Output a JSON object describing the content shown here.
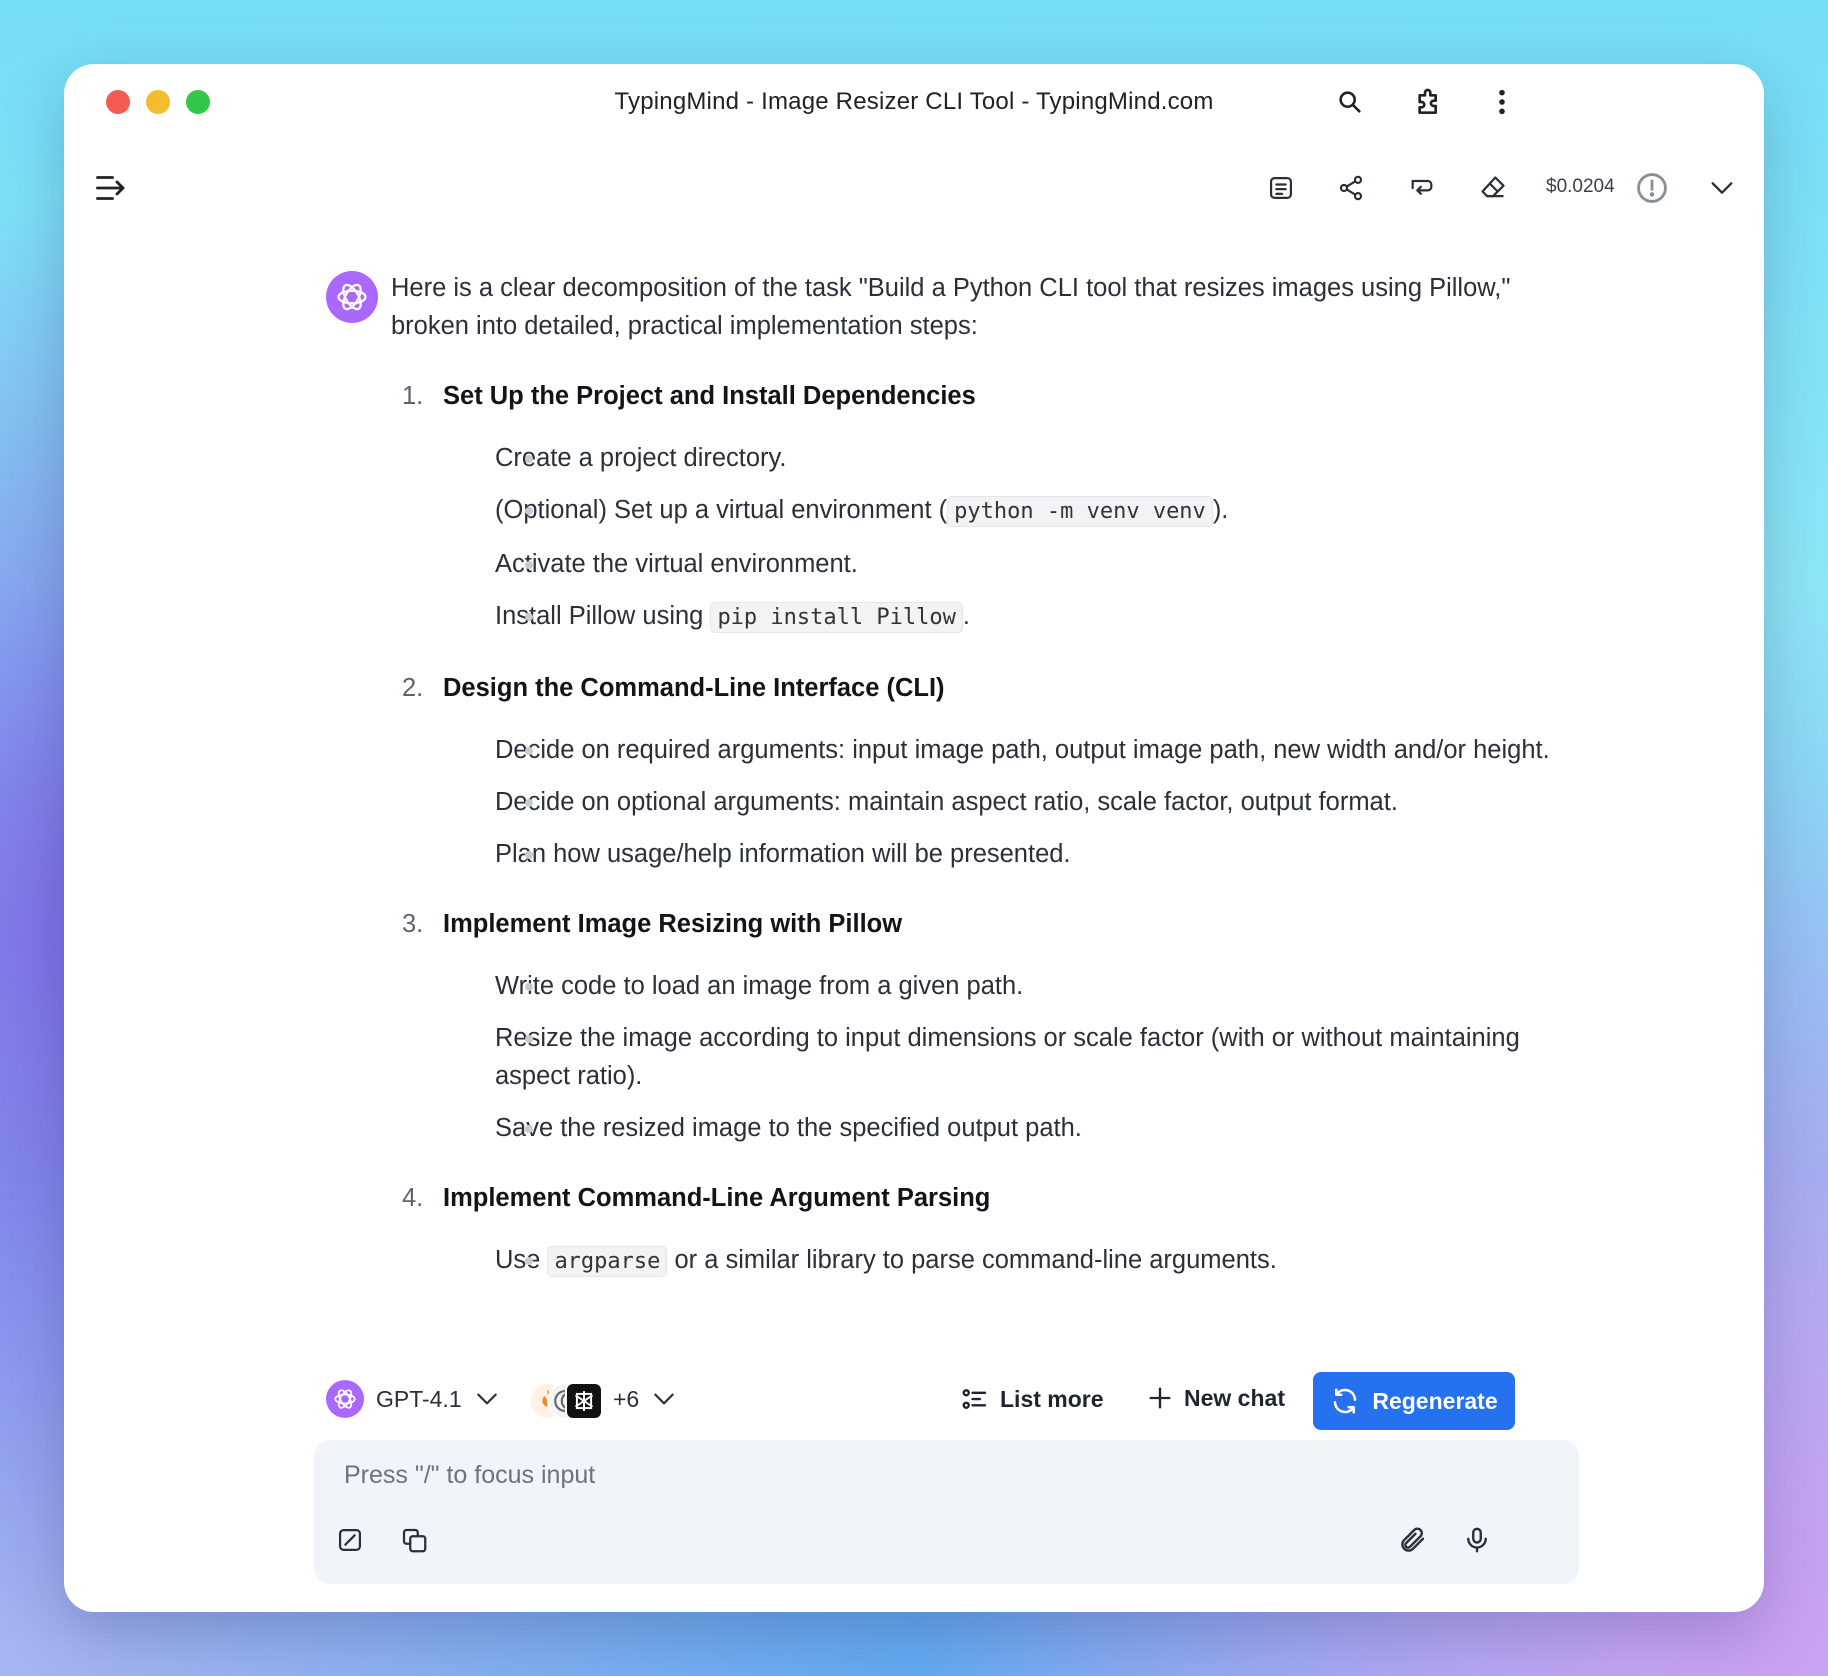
{
  "window": {
    "title": "TypingMind - Image Resizer CLI Tool - TypingMind.com"
  },
  "toolbar": {
    "cost": "$0.0204"
  },
  "message": {
    "intro": "Here is a clear decomposition of the task \"Build a Python CLI tool that resizes images using Pillow,\" broken into detailed, practical implementation steps:",
    "steps": [
      {
        "number": "1.",
        "title": "Set Up the Project and Install Dependencies",
        "bullets": [
          {
            "before": "Create a project directory.",
            "code": "",
            "after": ""
          },
          {
            "before": "(Optional) Set up a virtual environment (",
            "code": "python -m venv venv",
            "after": ")."
          },
          {
            "before": "Activate the virtual environment.",
            "code": "",
            "after": ""
          },
          {
            "before": "Install Pillow using ",
            "code": "pip install Pillow",
            "after": "."
          }
        ]
      },
      {
        "number": "2.",
        "title": "Design the Command-Line Interface (CLI)",
        "bullets": [
          {
            "before": "Decide on required arguments: input image path, output image path, new width and/or height.",
            "code": "",
            "after": ""
          },
          {
            "before": "Decide on optional arguments: maintain aspect ratio, scale factor, output format.",
            "code": "",
            "after": ""
          },
          {
            "before": "Plan how usage/help information will be presented.",
            "code": "",
            "after": ""
          }
        ]
      },
      {
        "number": "3.",
        "title": "Implement Image Resizing with Pillow",
        "bullets": [
          {
            "before": "Write code to load an image from a given path.",
            "code": "",
            "after": ""
          },
          {
            "before": "Resize the image according to input dimensions or scale factor (with or without maintaining aspect ratio).",
            "code": "",
            "after": ""
          },
          {
            "before": "Save the resized image to the specified output path.",
            "code": "",
            "after": ""
          }
        ]
      },
      {
        "number": "4.",
        "title": "Implement Command-Line Argument Parsing",
        "bullets": [
          {
            "before": "Use ",
            "code": "argparse",
            "after": " or a similar library to parse command-line arguments."
          }
        ]
      }
    ]
  },
  "composer": {
    "model": "GPT-4.1",
    "plugins_count": "+6",
    "list_more": "List more",
    "new_chat": "New chat",
    "regenerate": "Regenerate",
    "placeholder": "Press \"/\" to focus input"
  },
  "icons": {
    "search": "search-icon",
    "extensions": "puzzle-icon",
    "more": "more-vertical-icon",
    "sidebar": "sidebar-toggle-icon",
    "notes": "notes-icon",
    "share": "share-icon",
    "branch": "branch-icon",
    "eraser": "eraser-icon",
    "alert": "alert-circle-icon",
    "chevron": "chevron-down-icon",
    "openai": "openai-icon",
    "edit": "edit-icon",
    "copy": "copy-icon",
    "attach": "paperclip-icon",
    "mic": "microphone-icon"
  },
  "colors": {
    "accent": "#2671f0",
    "avatar": "#ab68ff"
  }
}
